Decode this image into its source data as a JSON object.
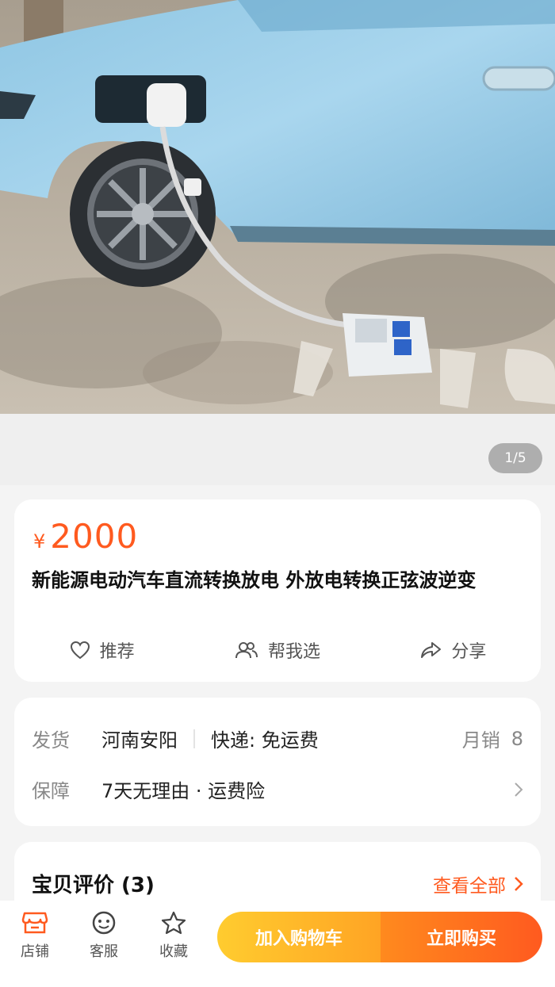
{
  "gallery": {
    "page_indicator": "1/5"
  },
  "product": {
    "currency_symbol": "¥",
    "price": "2000",
    "title": "新能源电动汽车直流转换放电 外放电转换正弦波逆变"
  },
  "actions": {
    "recommend": "推荐",
    "help_choose": "帮我选",
    "share": "分享"
  },
  "shipping": {
    "ship_label": "发货",
    "ship_from": "河南安阳",
    "express": "快递: 免运费",
    "sales_label": "月销",
    "sales_count": "8",
    "guarantee_label": "保障",
    "guarantee_value": "7天无理由 · 运费险"
  },
  "reviews": {
    "title": "宝贝评价 (3)",
    "view_all": "查看全部"
  },
  "bottom_bar": {
    "store": "店铺",
    "service": "客服",
    "favorite": "收藏",
    "add_to_cart": "加入购物车",
    "buy_now": "立即购买"
  },
  "colors": {
    "accent": "#ff5a1f",
    "cart_yellow": "#ffb627",
    "buy_orange": "#ff6a1f"
  },
  "icons": [
    "heart-icon",
    "people-icon",
    "share-icon",
    "chevron-right-icon",
    "store-icon",
    "service-face-icon",
    "star-icon"
  ]
}
